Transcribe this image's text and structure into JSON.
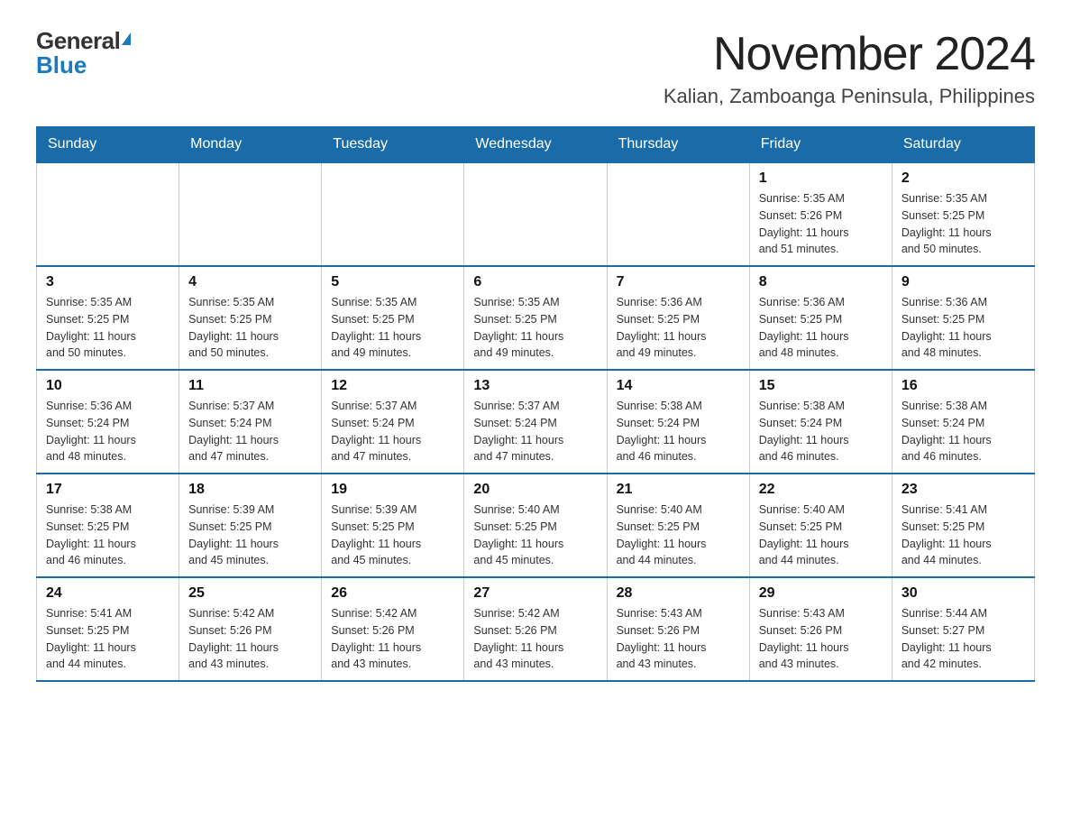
{
  "header": {
    "logo_general": "General",
    "logo_blue": "Blue",
    "month_title": "November 2024",
    "location": "Kalian, Zamboanga Peninsula, Philippines"
  },
  "weekdays": [
    "Sunday",
    "Monday",
    "Tuesday",
    "Wednesday",
    "Thursday",
    "Friday",
    "Saturday"
  ],
  "weeks": [
    [
      {
        "day": "",
        "info": ""
      },
      {
        "day": "",
        "info": ""
      },
      {
        "day": "",
        "info": ""
      },
      {
        "day": "",
        "info": ""
      },
      {
        "day": "",
        "info": ""
      },
      {
        "day": "1",
        "info": "Sunrise: 5:35 AM\nSunset: 5:26 PM\nDaylight: 11 hours\nand 51 minutes."
      },
      {
        "day": "2",
        "info": "Sunrise: 5:35 AM\nSunset: 5:25 PM\nDaylight: 11 hours\nand 50 minutes."
      }
    ],
    [
      {
        "day": "3",
        "info": "Sunrise: 5:35 AM\nSunset: 5:25 PM\nDaylight: 11 hours\nand 50 minutes."
      },
      {
        "day": "4",
        "info": "Sunrise: 5:35 AM\nSunset: 5:25 PM\nDaylight: 11 hours\nand 50 minutes."
      },
      {
        "day": "5",
        "info": "Sunrise: 5:35 AM\nSunset: 5:25 PM\nDaylight: 11 hours\nand 49 minutes."
      },
      {
        "day": "6",
        "info": "Sunrise: 5:35 AM\nSunset: 5:25 PM\nDaylight: 11 hours\nand 49 minutes."
      },
      {
        "day": "7",
        "info": "Sunrise: 5:36 AM\nSunset: 5:25 PM\nDaylight: 11 hours\nand 49 minutes."
      },
      {
        "day": "8",
        "info": "Sunrise: 5:36 AM\nSunset: 5:25 PM\nDaylight: 11 hours\nand 48 minutes."
      },
      {
        "day": "9",
        "info": "Sunrise: 5:36 AM\nSunset: 5:25 PM\nDaylight: 11 hours\nand 48 minutes."
      }
    ],
    [
      {
        "day": "10",
        "info": "Sunrise: 5:36 AM\nSunset: 5:24 PM\nDaylight: 11 hours\nand 48 minutes."
      },
      {
        "day": "11",
        "info": "Sunrise: 5:37 AM\nSunset: 5:24 PM\nDaylight: 11 hours\nand 47 minutes."
      },
      {
        "day": "12",
        "info": "Sunrise: 5:37 AM\nSunset: 5:24 PM\nDaylight: 11 hours\nand 47 minutes."
      },
      {
        "day": "13",
        "info": "Sunrise: 5:37 AM\nSunset: 5:24 PM\nDaylight: 11 hours\nand 47 minutes."
      },
      {
        "day": "14",
        "info": "Sunrise: 5:38 AM\nSunset: 5:24 PM\nDaylight: 11 hours\nand 46 minutes."
      },
      {
        "day": "15",
        "info": "Sunrise: 5:38 AM\nSunset: 5:24 PM\nDaylight: 11 hours\nand 46 minutes."
      },
      {
        "day": "16",
        "info": "Sunrise: 5:38 AM\nSunset: 5:24 PM\nDaylight: 11 hours\nand 46 minutes."
      }
    ],
    [
      {
        "day": "17",
        "info": "Sunrise: 5:38 AM\nSunset: 5:25 PM\nDaylight: 11 hours\nand 46 minutes."
      },
      {
        "day": "18",
        "info": "Sunrise: 5:39 AM\nSunset: 5:25 PM\nDaylight: 11 hours\nand 45 minutes."
      },
      {
        "day": "19",
        "info": "Sunrise: 5:39 AM\nSunset: 5:25 PM\nDaylight: 11 hours\nand 45 minutes."
      },
      {
        "day": "20",
        "info": "Sunrise: 5:40 AM\nSunset: 5:25 PM\nDaylight: 11 hours\nand 45 minutes."
      },
      {
        "day": "21",
        "info": "Sunrise: 5:40 AM\nSunset: 5:25 PM\nDaylight: 11 hours\nand 44 minutes."
      },
      {
        "day": "22",
        "info": "Sunrise: 5:40 AM\nSunset: 5:25 PM\nDaylight: 11 hours\nand 44 minutes."
      },
      {
        "day": "23",
        "info": "Sunrise: 5:41 AM\nSunset: 5:25 PM\nDaylight: 11 hours\nand 44 minutes."
      }
    ],
    [
      {
        "day": "24",
        "info": "Sunrise: 5:41 AM\nSunset: 5:25 PM\nDaylight: 11 hours\nand 44 minutes."
      },
      {
        "day": "25",
        "info": "Sunrise: 5:42 AM\nSunset: 5:26 PM\nDaylight: 11 hours\nand 43 minutes."
      },
      {
        "day": "26",
        "info": "Sunrise: 5:42 AM\nSunset: 5:26 PM\nDaylight: 11 hours\nand 43 minutes."
      },
      {
        "day": "27",
        "info": "Sunrise: 5:42 AM\nSunset: 5:26 PM\nDaylight: 11 hours\nand 43 minutes."
      },
      {
        "day": "28",
        "info": "Sunrise: 5:43 AM\nSunset: 5:26 PM\nDaylight: 11 hours\nand 43 minutes."
      },
      {
        "day": "29",
        "info": "Sunrise: 5:43 AM\nSunset: 5:26 PM\nDaylight: 11 hours\nand 43 minutes."
      },
      {
        "day": "30",
        "info": "Sunrise: 5:44 AM\nSunset: 5:27 PM\nDaylight: 11 hours\nand 42 minutes."
      }
    ]
  ]
}
